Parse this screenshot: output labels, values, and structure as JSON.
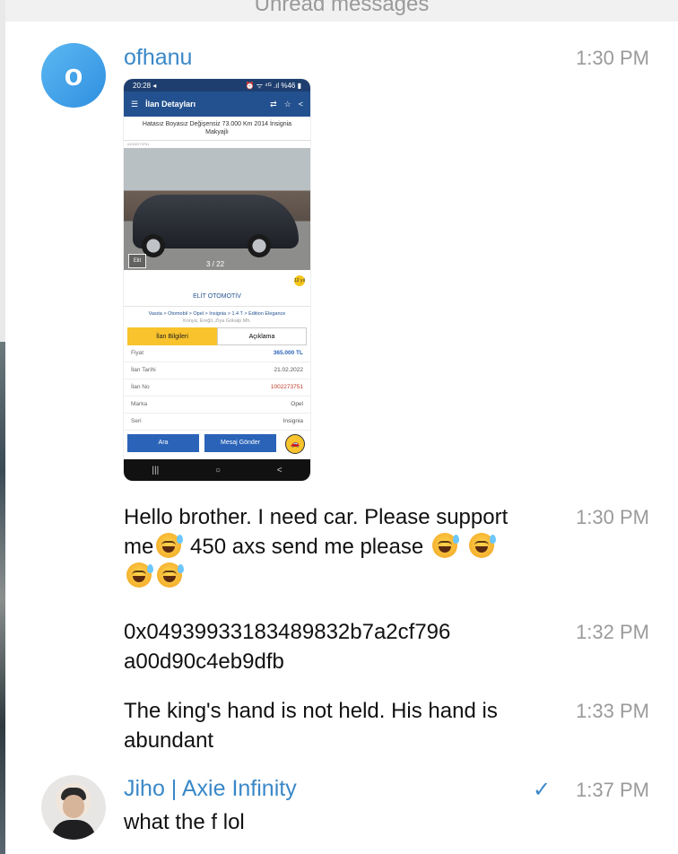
{
  "banner": {
    "unread": "Unread messages"
  },
  "messages": [
    {
      "sender": "ofhanu",
      "avatar_initial": "o",
      "time": "1:30 PM",
      "type": "image"
    },
    {
      "time": "1:30 PM",
      "text_a": "Hello brother. I need car. Please support me",
      "text_b": " 450 axs send me please "
    },
    {
      "time": "1:32 PM",
      "text": "0x04939933183489832b7a2cf796 a00d90c4eb9dfb"
    },
    {
      "time": "1:33 PM",
      "text": "The king's hand is not held. His hand is abundant"
    },
    {
      "sender": "Jiho | Axie Infinity",
      "time": "1:37 PM",
      "text": "what the f lol",
      "status_icon": "checkmark-icon"
    }
  ],
  "screenshot": {
    "status_time": "20:28 ◂",
    "status_right": "⏰ ᯤ ⁴ᴳ .ıl %46 ▮",
    "app_title": "İlan Detayları",
    "listing_title": "Hatasız Boyasız Değişensiz 73.000 Km 2014 İnsignia Makyajlı",
    "listing_small_id": "#1002273751",
    "photo_counter": "3 / 22",
    "photo_logo": "Elit",
    "dealer": "ELİT OTOMOTİV",
    "dealer_badge": "12 yıl",
    "breadcrumb": "Vasıta > Otomobil > Opel > Insignia > 1.4 T > Edition Elegance",
    "location": "Konya, Ereğli, Ziya Gökalp Mh.",
    "tab_info": "İlan Bilgileri",
    "tab_desc": "Açıklama",
    "rows": [
      {
        "label": "Fiyat",
        "value": "365.000 TL"
      },
      {
        "label": "İlan Tarihi",
        "value": "21.02.2022"
      },
      {
        "label": "İlan No",
        "value": "1002273751"
      },
      {
        "label": "Marka",
        "value": "Opel"
      },
      {
        "label": "Seri",
        "value": "Insignia"
      }
    ],
    "btn_call": "Ara",
    "btn_message": "Mesaj Gönder",
    "nav_recent": "|||",
    "nav_home": "○",
    "nav_back": "<"
  }
}
